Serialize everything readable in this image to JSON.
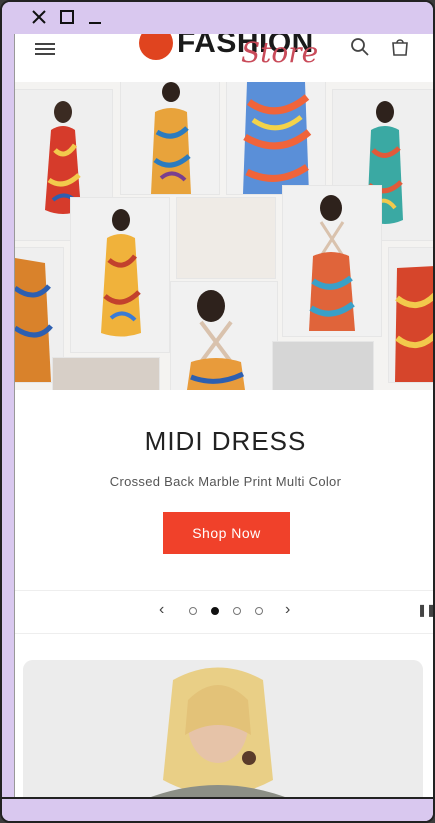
{
  "window": {
    "close_glyph": "✕",
    "max_glyph": "☐",
    "min_glyph": "_"
  },
  "header": {
    "logo_primary": "FASHION",
    "logo_secondary": "Store",
    "icons": [
      "menu-icon",
      "search-icon",
      "cart-icon"
    ]
  },
  "hero": {
    "title": "MIDI DRESS",
    "subtitle": "Crossed Back Marble Print Multi Color",
    "cta_label": "Shop Now",
    "accent_color": "#f0412a"
  },
  "carousel": {
    "prev_glyph": "‹",
    "next_glyph": "›",
    "slides": 4,
    "active_slide": 2,
    "pause_glyph": "❚❚"
  }
}
